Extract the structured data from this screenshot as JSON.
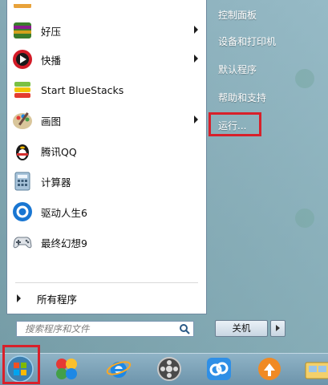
{
  "start_menu": {
    "pinned_programs": [
      {
        "label": "好压",
        "icon": "haozip-icon",
        "has_submenu": true
      },
      {
        "label": "快播",
        "icon": "qvod-icon",
        "has_submenu": true
      },
      {
        "label": "Start BlueStacks",
        "icon": "bluestacks-icon",
        "has_submenu": false
      },
      {
        "label": "画图",
        "icon": "paint-icon",
        "has_submenu": true
      },
      {
        "label": "腾讯QQ",
        "icon": "qq-penguin-icon",
        "has_submenu": false
      },
      {
        "label": "计算器",
        "icon": "calculator-icon",
        "has_submenu": false
      },
      {
        "label": "驱动人生6",
        "icon": "driver-life-icon",
        "has_submenu": false
      },
      {
        "label": "最终幻想9",
        "icon": "gamepad-icon",
        "has_submenu": false
      }
    ],
    "all_programs_label": "所有程序",
    "search_placeholder": "搜索程序和文件",
    "right_items": [
      {
        "label": "控制面板"
      },
      {
        "label": "设备和打印机"
      },
      {
        "label": "默认程序"
      },
      {
        "label": "帮助和支持"
      },
      {
        "label": "运行..."
      }
    ],
    "shutdown_label": "关机"
  },
  "taskbar": {
    "items": [
      "windows-start-orb-icon",
      "app-balls-icon",
      "internet-explorer-icon",
      "media-player-icon",
      "baidu-netdisk-icon",
      "orange-app-icon",
      "windows-explorer-icon"
    ]
  },
  "highlight_color": "#d8202a"
}
